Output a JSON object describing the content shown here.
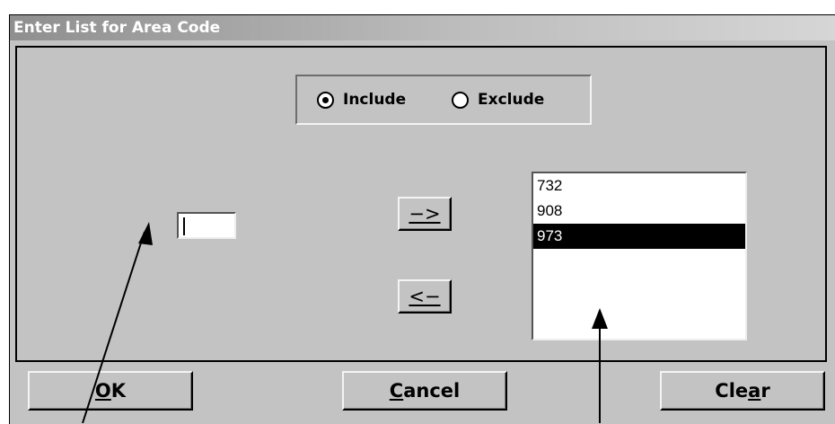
{
  "window": {
    "title": "Enter List for Area Code"
  },
  "mode": {
    "include_label": "Include",
    "exclude_label": "Exclude",
    "selected": "Include"
  },
  "input": {
    "value": ""
  },
  "buttons": {
    "add_arrow": "−>",
    "remove_arrow": "<−",
    "ok_mnemonic": "O",
    "ok_rest": "K",
    "cancel_mnemonic": "C",
    "cancel_rest": "ancel",
    "clear_prefix": "Cle",
    "clear_mnemonic": "a",
    "clear_suffix": "r"
  },
  "list": {
    "items": [
      "732",
      "908",
      "973"
    ],
    "selected_index": 2
  }
}
